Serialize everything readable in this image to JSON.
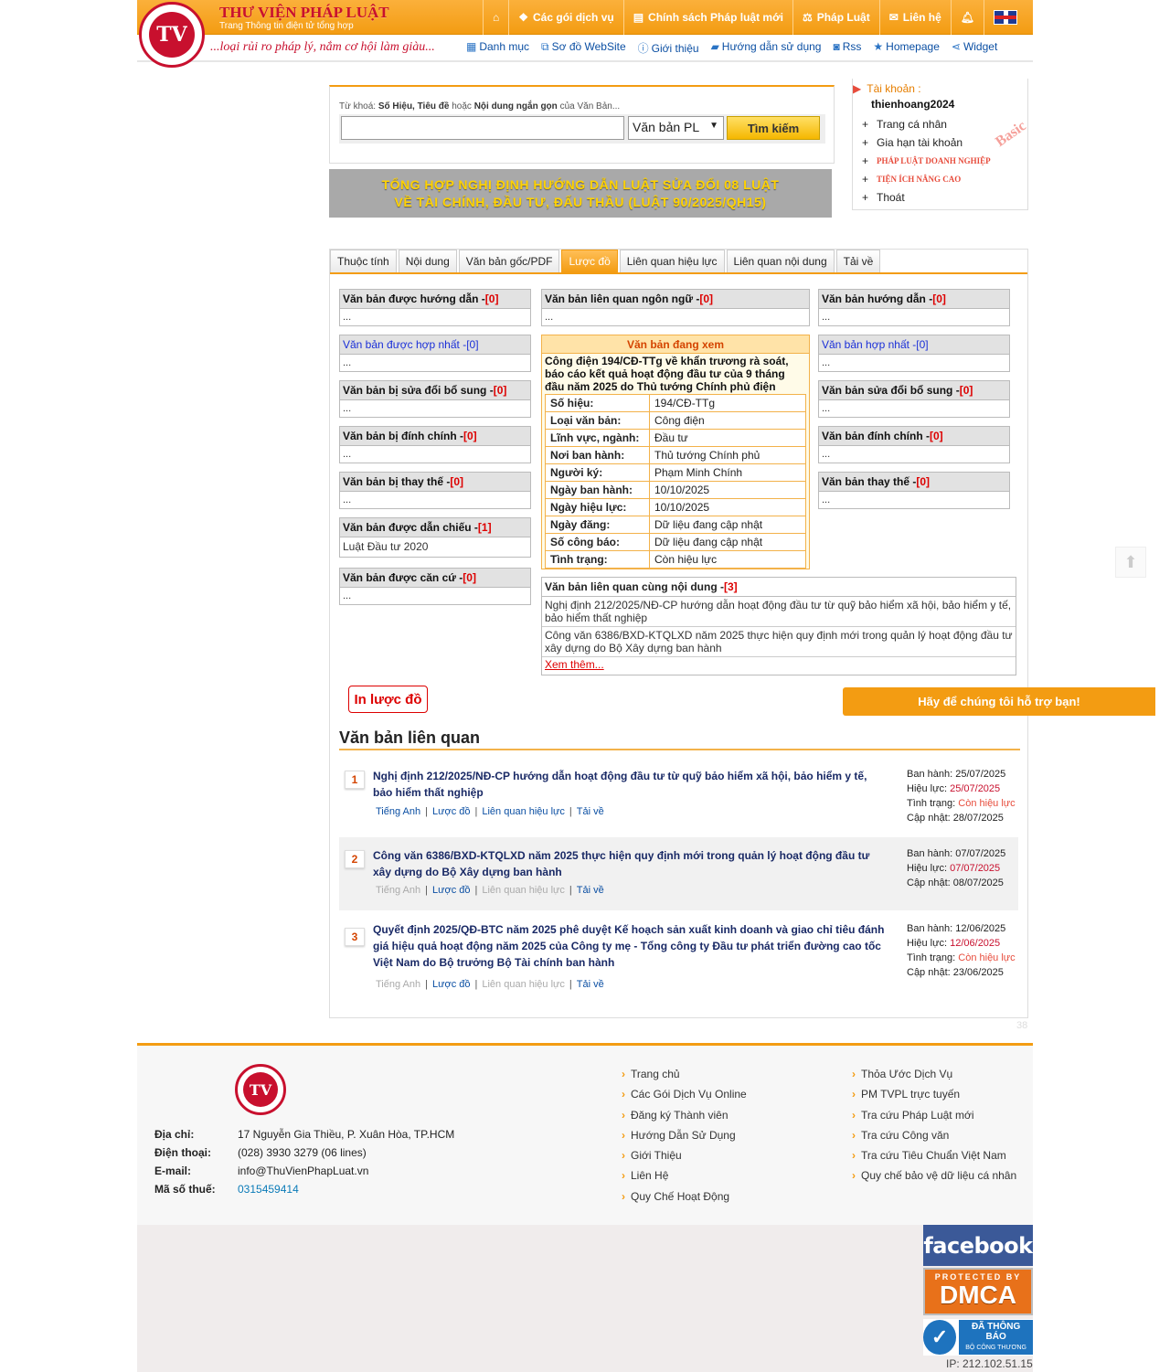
{
  "header": {
    "brand_title": "THƯ VIỆN PHÁP LUẬT",
    "brand_sub": "Trang Thông tin điện tử tổng hợp",
    "slogan": "...loại rủi ro pháp lý, nắm cơ hội làm giàu...",
    "logo_text": "TV",
    "topnav": [
      "Các gói dịch vụ",
      "Chính sách Pháp luật mới",
      "Pháp Luật",
      "Liên hệ"
    ],
    "subnav": [
      "Danh mục",
      "Sơ đồ WebSite",
      "Giới thiệu",
      "Hướng dẫn sử dụng",
      "Rss",
      "Homepage",
      "Widget"
    ]
  },
  "search": {
    "hint_prefix": "Từ khoá:",
    "hint_bold1": "Số Hiệu, Tiêu đề",
    "hint_mid": "hoặc",
    "hint_bold2": "Nội dung ngắn gọn",
    "hint_suffix": "của Văn Bản...",
    "value": "",
    "select_value": "Văn bản PL",
    "button": "Tìm kiếm"
  },
  "banner": {
    "line1": "TỔNG HỢP NGHỊ ĐỊNH HƯỚNG DẪN LUẬT SỬA ĐỔI 08 LUẬT",
    "line2": "VỀ TÀI CHÍNH, ĐẦU TƯ, ĐẤU THẦU (LUẬT 90/2025/QH15)"
  },
  "account": {
    "label": "Tài khoản :",
    "username": "thienhoang2024",
    "badge": "Basic",
    "items": [
      "Trang cá nhân",
      "Gia hạn tài khoản",
      "PHÁP LUẬT DOANH NGHIỆP",
      "TIỆN ÍCH NÂNG CAO",
      "Thoát"
    ]
  },
  "tabs": [
    "Thuộc tính",
    "Nội dung",
    "Văn bản gốc/PDF",
    "Lược đồ",
    "Liên quan hiệu lực",
    "Liên quan nội dung",
    "Tải về"
  ],
  "left_boxes": [
    {
      "title": "Văn bản được hướng dẫn - ",
      "count": "[0]",
      "body": "..."
    },
    {
      "title": "Văn bản được hợp nhất - ",
      "count": "[0]",
      "body": "..."
    },
    {
      "title": "Văn bản bị sửa đổi bổ sung - ",
      "count": "[0]",
      "body": "..."
    },
    {
      "title": "Văn bản bị đính chính - ",
      "count": "[0]",
      "body": "..."
    },
    {
      "title": "Văn bản bị thay thế - ",
      "count": "[0]",
      "body": "..."
    },
    {
      "title": "Văn bản được dẫn chiếu - ",
      "count": "[1]",
      "body": "Luật Đầu tư 2020"
    },
    {
      "title": "Văn bản được căn cứ - ",
      "count": "[0]",
      "body": "..."
    }
  ],
  "right_boxes": [
    {
      "title": "Văn bản hướng dẫn - ",
      "count": "[0]",
      "body": "..."
    },
    {
      "title": "Văn bản hợp nhất - ",
      "count": "[0]",
      "body": "..."
    },
    {
      "title": "Văn bản sửa đổi bổ sung - ",
      "count": "[0]",
      "body": "..."
    },
    {
      "title": "Văn bản đính chính - ",
      "count": "[0]",
      "body": "..."
    },
    {
      "title": "Văn bản thay thế - ",
      "count": "[0]",
      "body": "..."
    }
  ],
  "lang_box": {
    "title": "Văn bản liên quan ngôn ngữ - ",
    "count": "[0]",
    "body": "..."
  },
  "current": {
    "header": "Văn bản đang xem",
    "title": "Công điện 194/CĐ-TTg về khẩn trương rà soát, báo cáo kết quả hoạt động đầu tư của 9 tháng đầu năm 2025 do Thủ tướng Chính phủ điện",
    "rows": [
      {
        "k": "Số hiệu:",
        "v": "194/CĐ-TTg"
      },
      {
        "k": "Loại văn bản:",
        "v": "Công điện"
      },
      {
        "k": "Lĩnh vực, ngành:",
        "v": "Đầu tư"
      },
      {
        "k": "Nơi ban hành:",
        "v": "Thủ tướng Chính phủ"
      },
      {
        "k": "Người ký:",
        "v": "Phạm Minh Chính"
      },
      {
        "k": "Ngày ban hành:",
        "v": "10/10/2025"
      },
      {
        "k": "Ngày hiệu lực:",
        "v": "10/10/2025"
      },
      {
        "k": "Ngày đăng:",
        "v": "Dữ liệu đang cập nhật"
      },
      {
        "k": "Số công báo:",
        "v": "Dữ liệu đang cập nhật"
      },
      {
        "k": "Tình trạng:",
        "v": "Còn hiệu lực"
      }
    ]
  },
  "same_content": {
    "title": "Văn bản liên quan cùng nội dung - ",
    "count": "[3]",
    "rows": [
      "Nghị định 212/2025/NĐ-CP hướng dẫn hoạt động đầu tư từ quỹ bảo hiểm xã hội, bảo hiểm y tế, bảo hiểm thất nghiệp",
      "Công văn 6386/BXD-KTQLXD năm 2025 thực hiện quy định mới trong quản lý hoạt động đầu tư xây dựng do Bộ Xây dựng ban hành"
    ],
    "more": "Xem thêm..."
  },
  "print_button": "In lược đồ",
  "support_button": "Hãy để chúng tôi hỗ trợ bạn!",
  "related": {
    "title": "Văn bản liên quan",
    "link_labels": [
      "Tiếng Anh",
      "Lược đồ",
      "Liên quan hiệu lực",
      "Tải về"
    ],
    "items": [
      {
        "num": "1",
        "title": "Nghị định 212/2025/NĐ-CP hướng dẫn hoạt động đầu tư từ quỹ bảo hiểm xã hội, bảo hiểm y tế, bảo hiểm thất nghiệp",
        "issued_label": "Ban hành:",
        "issued": "25/07/2025",
        "effective_label": "Hiệu lực:",
        "effective": "25/07/2025",
        "status_label": "Tình trạng:",
        "status": "Còn hiệu lực",
        "updated_label": "Cập nhật:",
        "updated": "28/07/2025"
      },
      {
        "num": "2",
        "title": "Công văn 6386/BXD-KTQLXD năm 2025 thực hiện quy định mới trong quản lý hoạt động đầu tư xây dựng do Bộ Xây dựng ban hành",
        "issued_label": "Ban hành:",
        "issued": "07/07/2025",
        "effective_label": "Hiệu lực:",
        "effective": "07/07/2025",
        "updated_label": "Cập nhật:",
        "updated": "08/07/2025"
      },
      {
        "num": "3",
        "title": "Quyết định 2025/QĐ-BTC năm 2025 phê duyệt Kế hoạch sản xuất kinh doanh và giao chỉ tiêu đánh giá hiệu quả hoạt động năm 2025 của Công ty mẹ - Tổng công ty Đầu tư phát triển đường cao tốc Việt Nam do Bộ trưởng Bộ Tài chính ban hành",
        "issued_label": "Ban hành:",
        "issued": "12/06/2025",
        "effective_label": "Hiệu lực:",
        "effective": "12/06/2025",
        "status_label": "Tình trạng:",
        "status": "Còn hiệu lực",
        "updated_label": "Cập nhật:",
        "updated": "23/06/2025"
      }
    ]
  },
  "page_num": "38",
  "footer": {
    "logo_text": "TV",
    "info": [
      {
        "k": "Địa chỉ:",
        "v": "17 Nguyễn Gia Thiều, P. Xuân Hòa, TP.HCM"
      },
      {
        "k": "Điện thoại:",
        "v": "(028) 3930 3279 (06 lines)"
      },
      {
        "k": "E-mail:",
        "v": "info@ThuVienPhapLuat.vn"
      },
      {
        "k": "Mã số thuế:",
        "v": "0315459414"
      }
    ],
    "col1": [
      "Trang chủ",
      "Các Gói Dịch Vụ Online",
      "Đăng ký Thành viên",
      "Hướng Dẫn Sử Dụng",
      "Giới Thiệu",
      "Liên Hệ",
      "Quy Chế Hoạt Động"
    ],
    "col2": [
      "Thỏa Ước Dịch Vụ",
      "PM TVPL trực tuyến",
      "Tra cứu Pháp Luật mới",
      "Tra cứu Công văn",
      "Tra cứu Tiêu Chuẩn Việt Nam",
      "Quy chế bảo vệ dữ liệu cá nhân"
    ],
    "facebook": "facebook",
    "dmca_small": "PROTECTED BY",
    "dmca_big": "DMCA",
    "bct_line1": "ĐÃ THÔNG BÁO",
    "bct_line2": "BỘ CÔNG THƯƠNG",
    "ip": "IP: 212.102.51.15"
  },
  "colors": {
    "accent": "#f39c12",
    "brand_red": "#c8102e",
    "link": "#0b4fa3"
  }
}
